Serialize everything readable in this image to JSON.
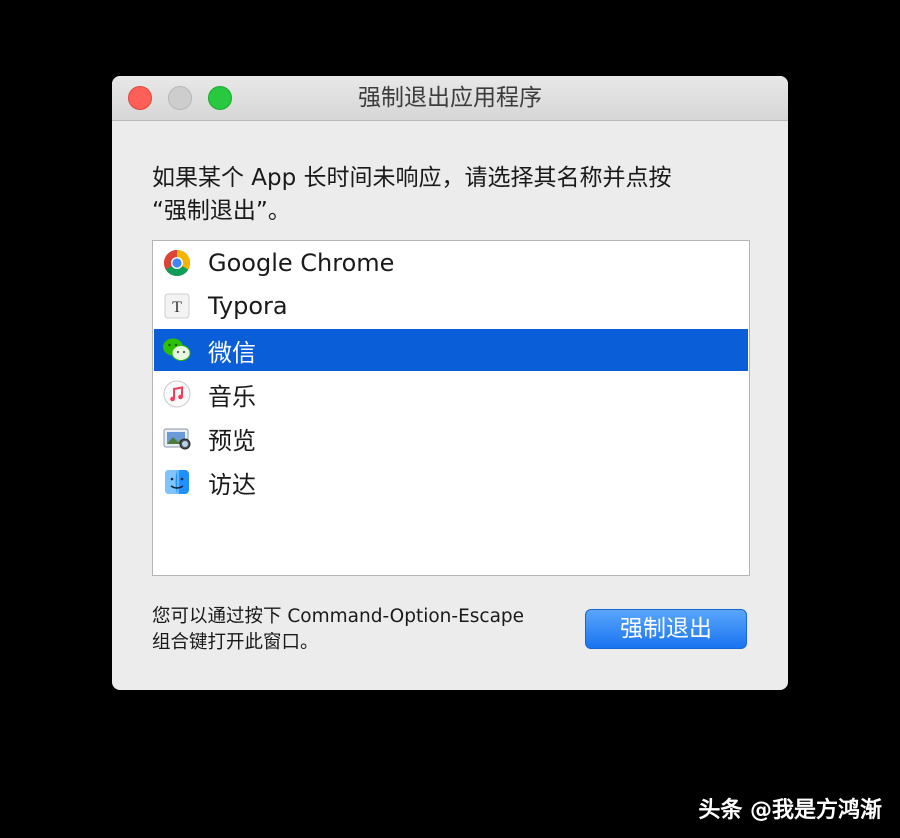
{
  "window": {
    "title": "强制退出应用程序"
  },
  "prompt": {
    "line1": "如果某个 App 长时间未响应，请选择其名称并点按",
    "line2": "“强制退出”。"
  },
  "apps": [
    {
      "label": "Google Chrome",
      "icon": "chrome-icon"
    },
    {
      "label": "Typora",
      "icon": "typora-icon"
    },
    {
      "label": "微信",
      "icon": "wechat-icon",
      "selected": true
    },
    {
      "label": "音乐",
      "icon": "music-icon"
    },
    {
      "label": "预览",
      "icon": "preview-icon"
    },
    {
      "label": "访达",
      "icon": "finder-icon"
    }
  ],
  "hint": {
    "line1": "您可以通过按下 Command-Option-Escape",
    "line2": "组合键打开此窗口。"
  },
  "buttons": {
    "force_quit": "强制退出"
  },
  "watermark": "头条 @我是方鸿渐",
  "colors": {
    "selection": "#0a5fd8",
    "button": "#1a74f0",
    "close": "#fe5f57",
    "maximize": "#28c840"
  }
}
